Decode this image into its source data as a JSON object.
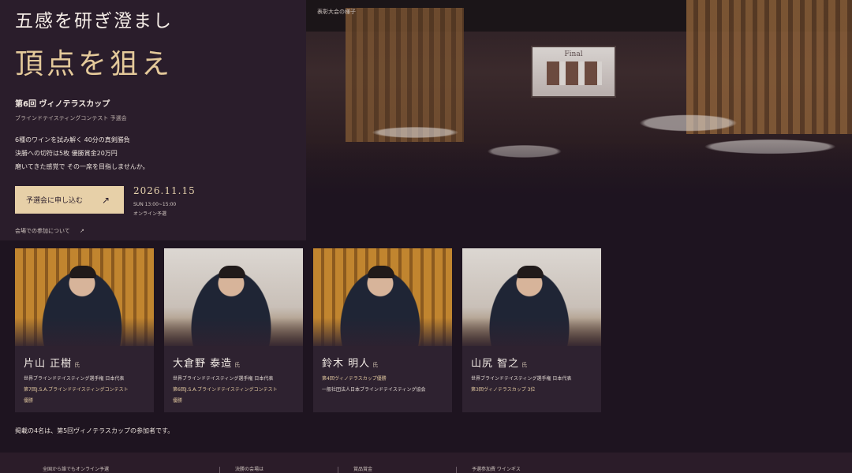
{
  "hero": {
    "venue_caption": "表彰大会の様子",
    "screen_label": "Final",
    "tagline": "五感を研ぎ澄まし",
    "headline": "頂点を狙え",
    "event_title": "第6回 ヴィノテラスカップ",
    "event_subtitle": "ブラインドテイスティングコンテスト 予選会",
    "description_lines": [
      "6種のワインを試み解く 40分の真剣勝負",
      "決勝への切符は5枚 優勝賞金20万円",
      "磨いてきた感覚で その一席を目指しませんか。"
    ],
    "apply_button": "予選会に申し込む",
    "apply_arrow": "↗",
    "date": "2026.11.15",
    "time": "SUN 13:00~15:00",
    "format": "オンライン予選",
    "link_label": "会場での参加について",
    "link_arrow": "↗"
  },
  "cards": [
    {
      "name": "片山 正樹",
      "honorific": "氏",
      "line1": "世界ブラインドテイスティング選手権 日本代表",
      "line2": "第7回J.S.A.ブラインドテイスティングコンテスト",
      "line3": "優勝"
    },
    {
      "name": "大倉野 泰造",
      "honorific": "氏",
      "line1": "世界ブラインドテイスティング選手権 日本代表",
      "line2": "第6回J.S.A.ブラインドテイスティングコンテスト",
      "line3": "優勝"
    },
    {
      "name": "鈴木 明人",
      "honorific": "氏",
      "line1": "第4回ヴィノテラスカップ優勝",
      "line2": "一般社団法人日本ブラインドテイスティング協会",
      "line3": ""
    },
    {
      "name": "山尻 智之",
      "honorific": "氏",
      "line1": "世界ブラインドテイスティング選手権 日本代表",
      "line2": "第3回ヴィノテラスカップ 3位",
      "line3": ""
    }
  ],
  "note": "掲載の4名は、第5回ヴィノテラスカップの参加者です。",
  "footer": {
    "items": [
      "全国から誰でもオンライン予選",
      "決勝の会場は",
      "賞品賞金",
      "予選参加費 ワインギス"
    ]
  }
}
